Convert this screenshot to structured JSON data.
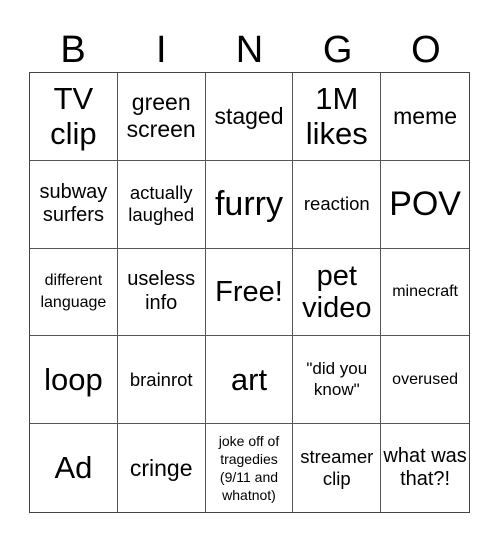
{
  "header": {
    "letters": [
      "B",
      "I",
      "N",
      "G",
      "O"
    ]
  },
  "cells": [
    "TV clip",
    "green screen",
    "staged",
    "1M likes",
    "meme",
    "subway surfers",
    "actually laughed",
    "furry",
    "reaction",
    "POV",
    "different language",
    "useless info",
    "Free!",
    "pet video",
    "minecraft",
    "loop",
    "brainrot",
    "art",
    "\"did you know\"",
    "overused",
    "Ad",
    "cringe",
    "joke off of tragedies (9/11 and whatnot)",
    "streamer clip",
    "what was that?!"
  ]
}
